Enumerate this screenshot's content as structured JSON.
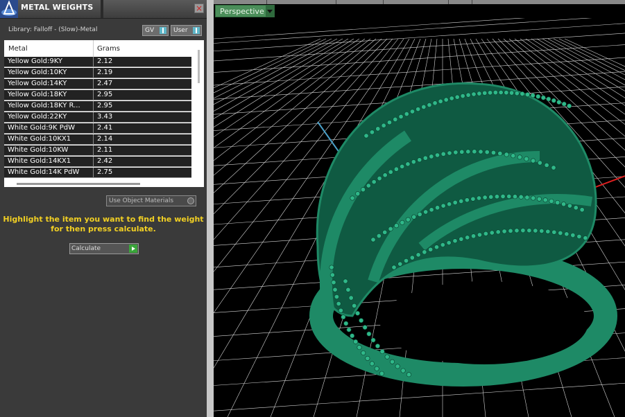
{
  "window": {
    "title": "METAL WEIGHTS",
    "close_label": "×"
  },
  "library": {
    "label": "Library: Falloff - (Slow)-Metal",
    "gv_label": "GV",
    "user_label": "User"
  },
  "table": {
    "columns": [
      "Metal",
      "Grams"
    ],
    "rows": [
      [
        "Yellow Gold:9KY",
        "2.12"
      ],
      [
        "Yellow Gold:10KY",
        "2.19"
      ],
      [
        "Yellow Gold:14KY",
        "2.47"
      ],
      [
        "Yellow Gold:18KY",
        "2.95"
      ],
      [
        "Yellow Gold:18KY R...",
        "2.95"
      ],
      [
        "Yellow Gold:22KY",
        "3.43"
      ],
      [
        "White Gold:9K PdW",
        "2.41"
      ],
      [
        "White Gold:10KX1",
        "2.14"
      ],
      [
        "White Gold:10KW",
        "2.11"
      ],
      [
        "White Gold:14KX1",
        "2.42"
      ],
      [
        "White Gold:14K PdW",
        "2.75"
      ]
    ]
  },
  "options": {
    "object_materials_label": "Use Object Materials"
  },
  "hint": {
    "line1": "Highlight the item you want to find the weight",
    "line2": "for then press calculate."
  },
  "actions": {
    "calculate_label": "Calculate"
  },
  "viewport": {
    "view_label": "Perspective",
    "model_color": "#1e8a66",
    "grid_color": "#d8d8d8",
    "axis_x_color": "#e02020",
    "axis_y_color": "#4aa0c8"
  }
}
